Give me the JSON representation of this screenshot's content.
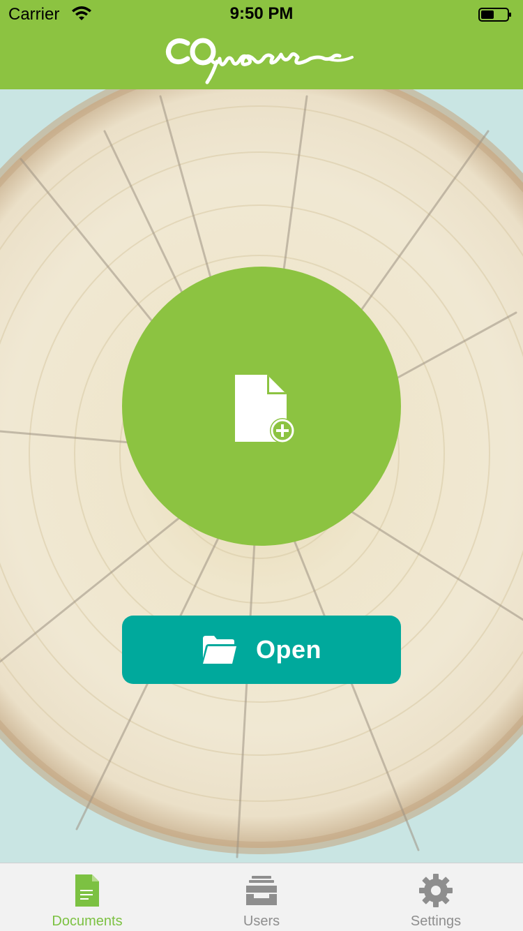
{
  "status_bar": {
    "carrier": "Carrier",
    "time": "9:50 PM"
  },
  "brand": {
    "logo_text": "COweave"
  },
  "main": {
    "new_document_icon": "new-document-icon",
    "open_label": "Open",
    "open_icon": "folder-icon"
  },
  "tabs": [
    {
      "label": "Documents",
      "icon": "document-icon",
      "active": true
    },
    {
      "label": "Users",
      "icon": "inbox-stack-icon",
      "active": false
    },
    {
      "label": "Settings",
      "icon": "gear-icon",
      "active": false
    }
  ],
  "colors": {
    "brand_green": "#8cc341",
    "open_teal": "#00a99c",
    "tab_active": "#7cc142",
    "tab_inactive": "#8e8e8e"
  }
}
